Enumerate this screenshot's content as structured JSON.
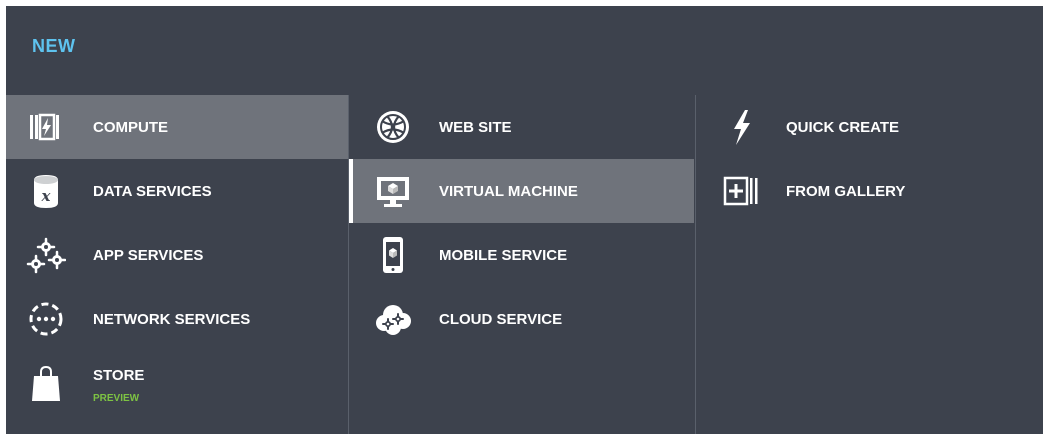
{
  "header": {
    "title": "NEW"
  },
  "categories": [
    {
      "label": "COMPUTE",
      "icon": "compute-icon",
      "selected": true
    },
    {
      "label": "DATA SERVICES",
      "icon": "data-services-icon"
    },
    {
      "label": "APP SERVICES",
      "icon": "gears-icon"
    },
    {
      "label": "NETWORK SERVICES",
      "icon": "network-icon"
    },
    {
      "label": "STORE",
      "sub": "PREVIEW",
      "icon": "shopping-bag-icon"
    }
  ],
  "services": [
    {
      "label": "WEB SITE",
      "icon": "globe-icon"
    },
    {
      "label": "VIRTUAL MACHINE",
      "icon": "monitor-icon",
      "selected": true
    },
    {
      "label": "MOBILE SERVICE",
      "icon": "mobile-icon"
    },
    {
      "label": "CLOUD SERVICE",
      "icon": "cloud-gears-icon"
    }
  ],
  "actions": [
    {
      "label": "QUICK CREATE",
      "icon": "lightning-icon"
    },
    {
      "label": "FROM GALLERY",
      "icon": "gallery-add-icon"
    }
  ],
  "colors": {
    "background": "#3d424d",
    "selected": "#6f737b",
    "title": "#5ec3ef",
    "preview": "#7dc243"
  }
}
